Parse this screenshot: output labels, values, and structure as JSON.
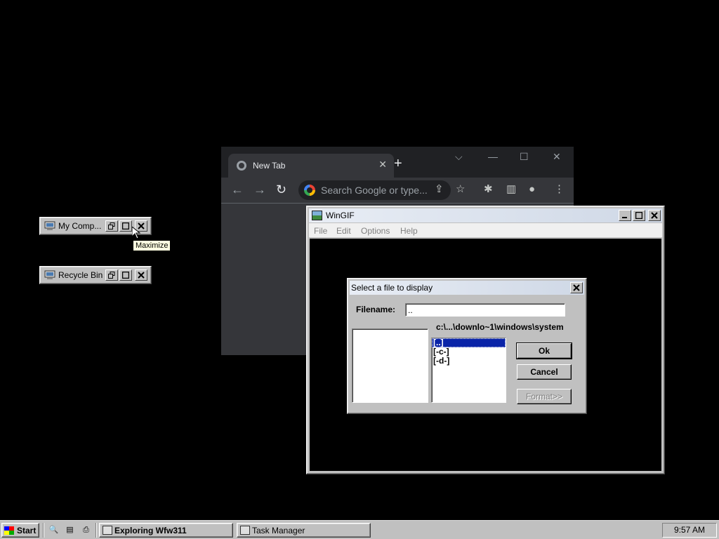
{
  "desktop": {
    "icons": [
      {
        "label": "My Comp..."
      },
      {
        "label": "Recycle Bin"
      }
    ],
    "tooltip": "Maximize"
  },
  "chrome": {
    "tab_title": "New Tab",
    "omnibox_placeholder": "Search Google or type..."
  },
  "wingif": {
    "title": "WinGIF",
    "menu": [
      "File",
      "Edit",
      "Options",
      "Help"
    ]
  },
  "dialog": {
    "title": "Select a file to display",
    "filename_label": "Filename:",
    "filename_value": "..",
    "path": "c:\\...\\downlo~1\\windows\\system",
    "dirs": [
      "[..]",
      "[-c-]",
      "[-d-]"
    ],
    "buttons": {
      "ok": "Ok",
      "cancel": "Cancel",
      "format": "Format>>"
    }
  },
  "taskbar": {
    "start": "Start",
    "tasks": [
      "Exploring Wfw311",
      "Task Manager"
    ],
    "clock": "9:57 AM"
  }
}
